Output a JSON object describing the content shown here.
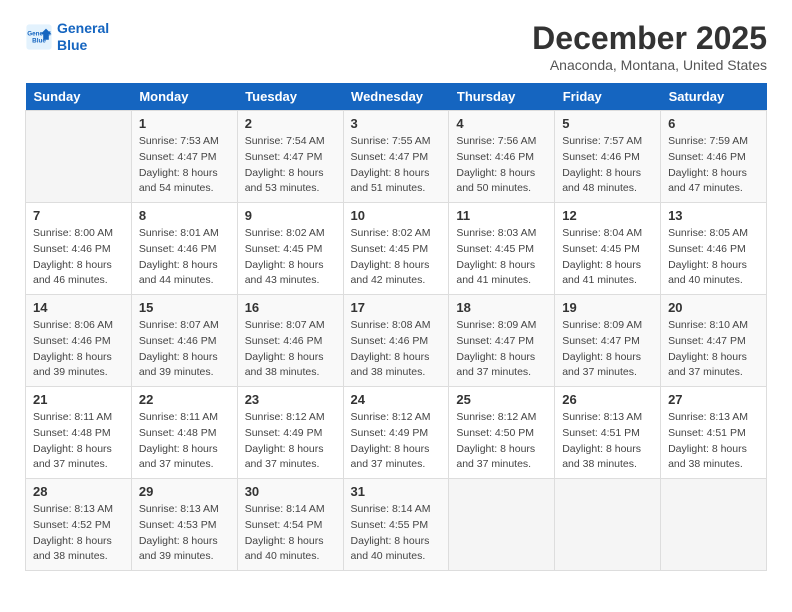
{
  "header": {
    "logo_line1": "General",
    "logo_line2": "Blue",
    "title": "December 2025",
    "subtitle": "Anaconda, Montana, United States"
  },
  "weekdays": [
    "Sunday",
    "Monday",
    "Tuesday",
    "Wednesday",
    "Thursday",
    "Friday",
    "Saturday"
  ],
  "weeks": [
    [
      {
        "day": "",
        "info": ""
      },
      {
        "day": "1",
        "info": "Sunrise: 7:53 AM\nSunset: 4:47 PM\nDaylight: 8 hours\nand 54 minutes."
      },
      {
        "day": "2",
        "info": "Sunrise: 7:54 AM\nSunset: 4:47 PM\nDaylight: 8 hours\nand 53 minutes."
      },
      {
        "day": "3",
        "info": "Sunrise: 7:55 AM\nSunset: 4:47 PM\nDaylight: 8 hours\nand 51 minutes."
      },
      {
        "day": "4",
        "info": "Sunrise: 7:56 AM\nSunset: 4:46 PM\nDaylight: 8 hours\nand 50 minutes."
      },
      {
        "day": "5",
        "info": "Sunrise: 7:57 AM\nSunset: 4:46 PM\nDaylight: 8 hours\nand 48 minutes."
      },
      {
        "day": "6",
        "info": "Sunrise: 7:59 AM\nSunset: 4:46 PM\nDaylight: 8 hours\nand 47 minutes."
      }
    ],
    [
      {
        "day": "7",
        "info": "Sunrise: 8:00 AM\nSunset: 4:46 PM\nDaylight: 8 hours\nand 46 minutes."
      },
      {
        "day": "8",
        "info": "Sunrise: 8:01 AM\nSunset: 4:46 PM\nDaylight: 8 hours\nand 44 minutes."
      },
      {
        "day": "9",
        "info": "Sunrise: 8:02 AM\nSunset: 4:45 PM\nDaylight: 8 hours\nand 43 minutes."
      },
      {
        "day": "10",
        "info": "Sunrise: 8:02 AM\nSunset: 4:45 PM\nDaylight: 8 hours\nand 42 minutes."
      },
      {
        "day": "11",
        "info": "Sunrise: 8:03 AM\nSunset: 4:45 PM\nDaylight: 8 hours\nand 41 minutes."
      },
      {
        "day": "12",
        "info": "Sunrise: 8:04 AM\nSunset: 4:45 PM\nDaylight: 8 hours\nand 41 minutes."
      },
      {
        "day": "13",
        "info": "Sunrise: 8:05 AM\nSunset: 4:46 PM\nDaylight: 8 hours\nand 40 minutes."
      }
    ],
    [
      {
        "day": "14",
        "info": "Sunrise: 8:06 AM\nSunset: 4:46 PM\nDaylight: 8 hours\nand 39 minutes."
      },
      {
        "day": "15",
        "info": "Sunrise: 8:07 AM\nSunset: 4:46 PM\nDaylight: 8 hours\nand 39 minutes."
      },
      {
        "day": "16",
        "info": "Sunrise: 8:07 AM\nSunset: 4:46 PM\nDaylight: 8 hours\nand 38 minutes."
      },
      {
        "day": "17",
        "info": "Sunrise: 8:08 AM\nSunset: 4:46 PM\nDaylight: 8 hours\nand 38 minutes."
      },
      {
        "day": "18",
        "info": "Sunrise: 8:09 AM\nSunset: 4:47 PM\nDaylight: 8 hours\nand 37 minutes."
      },
      {
        "day": "19",
        "info": "Sunrise: 8:09 AM\nSunset: 4:47 PM\nDaylight: 8 hours\nand 37 minutes."
      },
      {
        "day": "20",
        "info": "Sunrise: 8:10 AM\nSunset: 4:47 PM\nDaylight: 8 hours\nand 37 minutes."
      }
    ],
    [
      {
        "day": "21",
        "info": "Sunrise: 8:11 AM\nSunset: 4:48 PM\nDaylight: 8 hours\nand 37 minutes."
      },
      {
        "day": "22",
        "info": "Sunrise: 8:11 AM\nSunset: 4:48 PM\nDaylight: 8 hours\nand 37 minutes."
      },
      {
        "day": "23",
        "info": "Sunrise: 8:12 AM\nSunset: 4:49 PM\nDaylight: 8 hours\nand 37 minutes."
      },
      {
        "day": "24",
        "info": "Sunrise: 8:12 AM\nSunset: 4:49 PM\nDaylight: 8 hours\nand 37 minutes."
      },
      {
        "day": "25",
        "info": "Sunrise: 8:12 AM\nSunset: 4:50 PM\nDaylight: 8 hours\nand 37 minutes."
      },
      {
        "day": "26",
        "info": "Sunrise: 8:13 AM\nSunset: 4:51 PM\nDaylight: 8 hours\nand 38 minutes."
      },
      {
        "day": "27",
        "info": "Sunrise: 8:13 AM\nSunset: 4:51 PM\nDaylight: 8 hours\nand 38 minutes."
      }
    ],
    [
      {
        "day": "28",
        "info": "Sunrise: 8:13 AM\nSunset: 4:52 PM\nDaylight: 8 hours\nand 38 minutes."
      },
      {
        "day": "29",
        "info": "Sunrise: 8:13 AM\nSunset: 4:53 PM\nDaylight: 8 hours\nand 39 minutes."
      },
      {
        "day": "30",
        "info": "Sunrise: 8:14 AM\nSunset: 4:54 PM\nDaylight: 8 hours\nand 40 minutes."
      },
      {
        "day": "31",
        "info": "Sunrise: 8:14 AM\nSunset: 4:55 PM\nDaylight: 8 hours\nand 40 minutes."
      },
      {
        "day": "",
        "info": ""
      },
      {
        "day": "",
        "info": ""
      },
      {
        "day": "",
        "info": ""
      }
    ]
  ]
}
